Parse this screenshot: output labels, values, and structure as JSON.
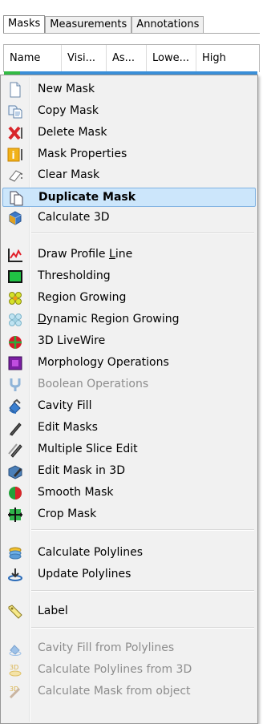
{
  "tabs": [
    {
      "label": "Masks",
      "active": true
    },
    {
      "label": "Measurements",
      "active": false
    },
    {
      "label": "Annotations",
      "active": false
    }
  ],
  "columns": [
    "Name",
    "Visi...",
    "As...",
    "Lowe...",
    "High"
  ],
  "menu": {
    "groups": [
      [
        {
          "label": "New Mask",
          "icon": "new-document-icon",
          "enabled": true
        },
        {
          "label": "Copy Mask",
          "icon": "copy-icon",
          "enabled": true
        },
        {
          "label": "Delete Mask",
          "icon": "delete-x-icon",
          "enabled": true
        },
        {
          "label": "Mask Properties",
          "icon": "info-icon",
          "enabled": true
        },
        {
          "label": "Clear Mask",
          "icon": "eraser-icon",
          "enabled": true
        },
        {
          "label": "Duplicate Mask",
          "icon": "duplicate-icon",
          "enabled": true,
          "highlighted": true
        },
        {
          "label": "Calculate 3D",
          "icon": "cube-3d-icon",
          "enabled": true
        }
      ],
      [
        {
          "label": "Draw Profile Line",
          "icon": "profile-line-icon",
          "enabled": true
        },
        {
          "label": "Thresholding",
          "icon": "threshold-icon",
          "enabled": true
        },
        {
          "label": "Region Growing",
          "icon": "region-growing-icon",
          "enabled": true
        },
        {
          "label": "Dynamic Region Growing",
          "icon": "dynamic-region-growing-icon",
          "enabled": true
        },
        {
          "label": "3D LiveWire",
          "icon": "livewire-icon",
          "enabled": true
        },
        {
          "label": "Morphology Operations",
          "icon": "morphology-icon",
          "enabled": true
        },
        {
          "label": "Boolean Operations",
          "icon": "boolean-icon",
          "enabled": false
        },
        {
          "label": "Cavity Fill",
          "icon": "cavity-fill-icon",
          "enabled": true
        },
        {
          "label": "Edit Masks",
          "icon": "pencil-icon",
          "enabled": true
        },
        {
          "label": "Multiple Slice Edit",
          "icon": "multi-slice-pencil-icon",
          "enabled": true
        },
        {
          "label": "Edit Mask in 3D",
          "icon": "edit-3d-icon",
          "enabled": true
        },
        {
          "label": "Smooth Mask",
          "icon": "smooth-icon",
          "enabled": true
        },
        {
          "label": "Crop Mask",
          "icon": "crop-icon",
          "enabled": true
        }
      ],
      [
        {
          "label": "Calculate Polylines",
          "icon": "polylines-icon",
          "enabled": true
        },
        {
          "label": "Update Polylines",
          "icon": "update-polylines-icon",
          "enabled": true
        }
      ],
      [
        {
          "label": "Label",
          "icon": "label-tag-icon",
          "enabled": true
        }
      ],
      [
        {
          "label": "Cavity Fill from Polylines",
          "icon": "cavity-fill-polylines-icon",
          "enabled": false
        },
        {
          "label": "Calculate Polylines from 3D",
          "icon": "polylines-3d-icon",
          "enabled": false
        },
        {
          "label": "Calculate Mask from object",
          "icon": "mask-from-object-icon",
          "enabled": false
        }
      ]
    ]
  },
  "colors": {
    "highlight_bg": "#cce6fb",
    "highlight_border": "#7fb2e2",
    "menu_bg": "#f1f1f1",
    "disabled_text": "#8d8d8d"
  }
}
